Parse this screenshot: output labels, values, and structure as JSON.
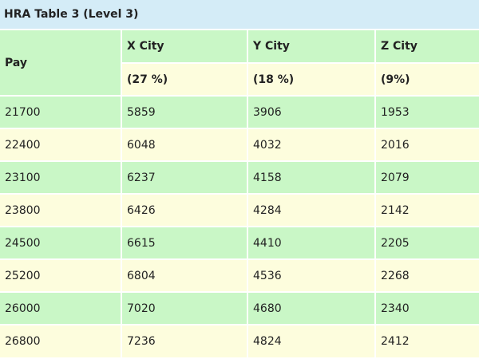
{
  "title": "HRA Table 3 (Level 3)",
  "headers": {
    "pay": "Pay",
    "x_city": "X City",
    "y_city": "Y City",
    "z_city": "Z City",
    "x_rate": "(27 %)",
    "y_rate": "(18 %)",
    "z_rate": "(9%)"
  },
  "rows": [
    [
      "21700",
      "5859",
      "3906",
      "1953"
    ],
    [
      "22400",
      "6048",
      "4032",
      "2016"
    ],
    [
      "23100",
      "6237",
      "4158",
      "2079"
    ],
    [
      "23800",
      "6426",
      "4284",
      "2142"
    ],
    [
      "24500",
      "6615",
      "4410",
      "2205"
    ],
    [
      "25200",
      "6804",
      "4536",
      "2268"
    ],
    [
      "26000",
      "7020",
      "4680",
      "2340"
    ],
    [
      "26800",
      "7236",
      "4824",
      "2412"
    ]
  ],
  "colors": {
    "caption_bg": "#d4ecf7",
    "green_row": "#c9f7c6",
    "cream_row": "#fdfddd"
  }
}
